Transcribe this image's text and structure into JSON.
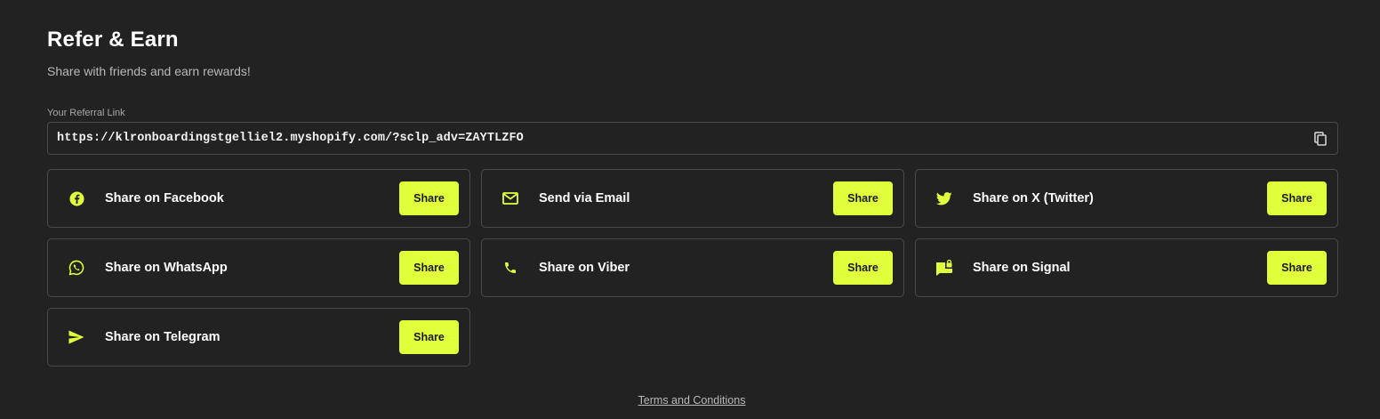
{
  "header": {
    "title": "Refer & Earn",
    "subtitle": "Share with friends and earn rewards!"
  },
  "referral": {
    "label": "Your Referral Link",
    "link": "https://klronboardingstgelliel2.myshopify.com/?sclp_adv=ZAYTLZFO",
    "copy_icon": "copy-icon"
  },
  "share_options": [
    {
      "label": "Share on Facebook",
      "icon": "facebook-icon",
      "button": "Share"
    },
    {
      "label": "Send via Email",
      "icon": "email-icon",
      "button": "Share"
    },
    {
      "label": "Share on X (Twitter)",
      "icon": "twitter-icon",
      "button": "Share"
    },
    {
      "label": "Share on WhatsApp",
      "icon": "whatsapp-icon",
      "button": "Share"
    },
    {
      "label": "Share on Viber",
      "icon": "phone-icon",
      "button": "Share"
    },
    {
      "label": "Share on Signal",
      "icon": "signal-icon",
      "button": "Share"
    },
    {
      "label": "Share on Telegram",
      "icon": "telegram-icon",
      "button": "Share"
    }
  ],
  "footer": {
    "terms": "Terms and Conditions"
  },
  "colors": {
    "background": "#222223",
    "accent": "#e2ff3b",
    "border": "#4a4a4c"
  }
}
